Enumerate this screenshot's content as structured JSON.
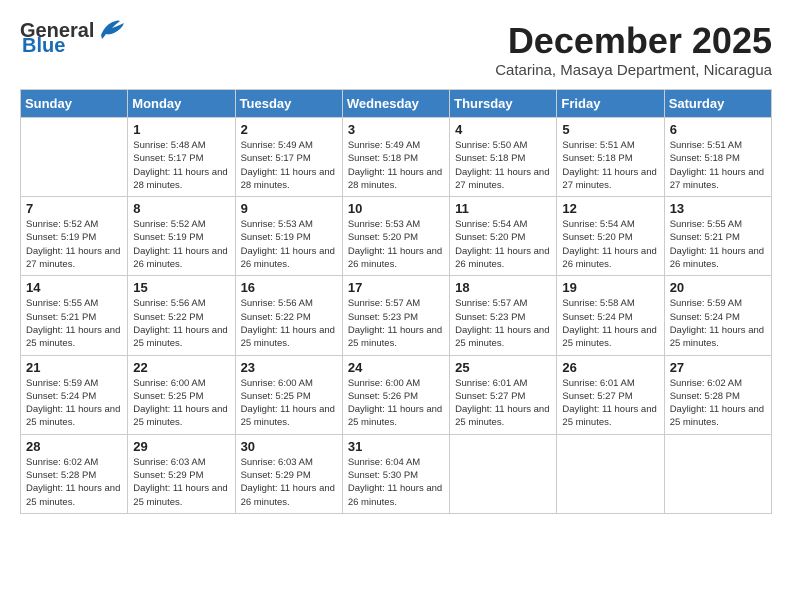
{
  "header": {
    "logo_general": "General",
    "logo_blue": "Blue",
    "month_title": "December 2025",
    "subtitle": "Catarina, Masaya Department, Nicaragua"
  },
  "weekdays": [
    "Sunday",
    "Monday",
    "Tuesday",
    "Wednesday",
    "Thursday",
    "Friday",
    "Saturday"
  ],
  "weeks": [
    [
      {
        "day": "",
        "info": ""
      },
      {
        "day": "1",
        "info": "Sunrise: 5:48 AM\nSunset: 5:17 PM\nDaylight: 11 hours and 28 minutes."
      },
      {
        "day": "2",
        "info": "Sunrise: 5:49 AM\nSunset: 5:17 PM\nDaylight: 11 hours and 28 minutes."
      },
      {
        "day": "3",
        "info": "Sunrise: 5:49 AM\nSunset: 5:18 PM\nDaylight: 11 hours and 28 minutes."
      },
      {
        "day": "4",
        "info": "Sunrise: 5:50 AM\nSunset: 5:18 PM\nDaylight: 11 hours and 27 minutes."
      },
      {
        "day": "5",
        "info": "Sunrise: 5:51 AM\nSunset: 5:18 PM\nDaylight: 11 hours and 27 minutes."
      },
      {
        "day": "6",
        "info": "Sunrise: 5:51 AM\nSunset: 5:18 PM\nDaylight: 11 hours and 27 minutes."
      }
    ],
    [
      {
        "day": "7",
        "info": "Sunrise: 5:52 AM\nSunset: 5:19 PM\nDaylight: 11 hours and 27 minutes."
      },
      {
        "day": "8",
        "info": "Sunrise: 5:52 AM\nSunset: 5:19 PM\nDaylight: 11 hours and 26 minutes."
      },
      {
        "day": "9",
        "info": "Sunrise: 5:53 AM\nSunset: 5:19 PM\nDaylight: 11 hours and 26 minutes."
      },
      {
        "day": "10",
        "info": "Sunrise: 5:53 AM\nSunset: 5:20 PM\nDaylight: 11 hours and 26 minutes."
      },
      {
        "day": "11",
        "info": "Sunrise: 5:54 AM\nSunset: 5:20 PM\nDaylight: 11 hours and 26 minutes."
      },
      {
        "day": "12",
        "info": "Sunrise: 5:54 AM\nSunset: 5:20 PM\nDaylight: 11 hours and 26 minutes."
      },
      {
        "day": "13",
        "info": "Sunrise: 5:55 AM\nSunset: 5:21 PM\nDaylight: 11 hours and 26 minutes."
      }
    ],
    [
      {
        "day": "14",
        "info": "Sunrise: 5:55 AM\nSunset: 5:21 PM\nDaylight: 11 hours and 25 minutes."
      },
      {
        "day": "15",
        "info": "Sunrise: 5:56 AM\nSunset: 5:22 PM\nDaylight: 11 hours and 25 minutes."
      },
      {
        "day": "16",
        "info": "Sunrise: 5:56 AM\nSunset: 5:22 PM\nDaylight: 11 hours and 25 minutes."
      },
      {
        "day": "17",
        "info": "Sunrise: 5:57 AM\nSunset: 5:23 PM\nDaylight: 11 hours and 25 minutes."
      },
      {
        "day": "18",
        "info": "Sunrise: 5:57 AM\nSunset: 5:23 PM\nDaylight: 11 hours and 25 minutes."
      },
      {
        "day": "19",
        "info": "Sunrise: 5:58 AM\nSunset: 5:24 PM\nDaylight: 11 hours and 25 minutes."
      },
      {
        "day": "20",
        "info": "Sunrise: 5:59 AM\nSunset: 5:24 PM\nDaylight: 11 hours and 25 minutes."
      }
    ],
    [
      {
        "day": "21",
        "info": "Sunrise: 5:59 AM\nSunset: 5:24 PM\nDaylight: 11 hours and 25 minutes."
      },
      {
        "day": "22",
        "info": "Sunrise: 6:00 AM\nSunset: 5:25 PM\nDaylight: 11 hours and 25 minutes."
      },
      {
        "day": "23",
        "info": "Sunrise: 6:00 AM\nSunset: 5:25 PM\nDaylight: 11 hours and 25 minutes."
      },
      {
        "day": "24",
        "info": "Sunrise: 6:00 AM\nSunset: 5:26 PM\nDaylight: 11 hours and 25 minutes."
      },
      {
        "day": "25",
        "info": "Sunrise: 6:01 AM\nSunset: 5:27 PM\nDaylight: 11 hours and 25 minutes."
      },
      {
        "day": "26",
        "info": "Sunrise: 6:01 AM\nSunset: 5:27 PM\nDaylight: 11 hours and 25 minutes."
      },
      {
        "day": "27",
        "info": "Sunrise: 6:02 AM\nSunset: 5:28 PM\nDaylight: 11 hours and 25 minutes."
      }
    ],
    [
      {
        "day": "28",
        "info": "Sunrise: 6:02 AM\nSunset: 5:28 PM\nDaylight: 11 hours and 25 minutes."
      },
      {
        "day": "29",
        "info": "Sunrise: 6:03 AM\nSunset: 5:29 PM\nDaylight: 11 hours and 25 minutes."
      },
      {
        "day": "30",
        "info": "Sunrise: 6:03 AM\nSunset: 5:29 PM\nDaylight: 11 hours and 26 minutes."
      },
      {
        "day": "31",
        "info": "Sunrise: 6:04 AM\nSunset: 5:30 PM\nDaylight: 11 hours and 26 minutes."
      },
      {
        "day": "",
        "info": ""
      },
      {
        "day": "",
        "info": ""
      },
      {
        "day": "",
        "info": ""
      }
    ]
  ]
}
